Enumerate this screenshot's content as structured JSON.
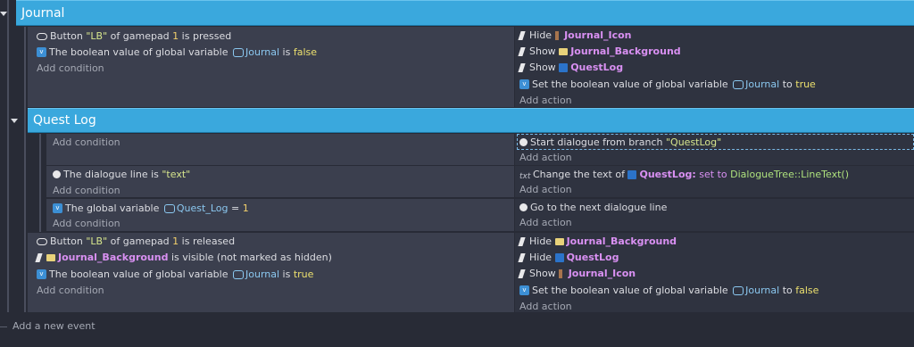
{
  "groups": {
    "journal_title": "Journal",
    "questlog_title": "Quest Log"
  },
  "labels": {
    "add_condition": "Add condition",
    "add_action": "Add action",
    "add_event": "Add a new event"
  },
  "event1": {
    "c1": {
      "a": "Button",
      "b": "\"LB\"",
      "c": "of gamepad",
      "d": "1",
      "e": "is pressed"
    },
    "c2": {
      "a": "The boolean value of global variable",
      "b": "Journal",
      "c": "is",
      "d": "false"
    },
    "a1": {
      "a": "Hide",
      "b": "Journal_Icon"
    },
    "a2": {
      "a": "Show",
      "b": "Journal_Background"
    },
    "a3": {
      "a": "Show",
      "b": "QuestLog"
    },
    "a4": {
      "a": "Set the boolean value of global variable",
      "b": "Journal",
      "c": "to",
      "d": "true"
    }
  },
  "event2": {
    "a1": {
      "a": "Start dialogue from branch",
      "b": "\"QuestLog\""
    }
  },
  "event3": {
    "c1": {
      "a": "The dialogue line is",
      "b": "\"text\""
    },
    "a1": {
      "a": "Change the text of",
      "b": "QuestLog:",
      "c": "set to",
      "d": "DialogueTree::LineText()"
    }
  },
  "event4": {
    "c1": {
      "a": "The global variable",
      "b": "Quest_Log",
      "c": "=",
      "d": "1"
    },
    "a1": {
      "a": "Go to the next dialogue line"
    }
  },
  "event5": {
    "c1": {
      "a": "Button",
      "b": "\"LB\"",
      "c": "of gamepad",
      "d": "1",
      "e": "is released"
    },
    "c2": {
      "a": "Journal_Background",
      "b": "is visible (not marked as hidden)"
    },
    "c3": {
      "a": "The boolean value of global variable",
      "b": "Journal",
      "c": "is",
      "d": "true"
    },
    "a1": {
      "a": "Hide",
      "b": "Journal_Background"
    },
    "a2": {
      "a": "Hide",
      "b": "QuestLog"
    },
    "a3": {
      "a": "Show",
      "b": "Journal_Icon"
    },
    "a4": {
      "a": "Set the boolean value of global variable",
      "b": "Journal",
      "c": "to",
      "d": "false"
    }
  }
}
